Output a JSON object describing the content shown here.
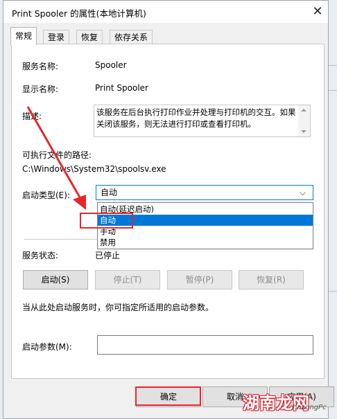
{
  "window": {
    "title": "Print Spooler 的属性(本地计算机)"
  },
  "tabs": [
    {
      "label": "常规",
      "active": true
    },
    {
      "label": "登录"
    },
    {
      "label": "恢复"
    },
    {
      "label": "依存关系"
    }
  ],
  "general": {
    "service_name_label": "服务名称:",
    "service_name_value": "Spooler",
    "display_name_label": "显示名称:",
    "display_name_value": "Print Spooler",
    "description_label": "描述:",
    "description_value": "该服务在后台执行打印作业并处理与打印机的交互。如果关闭该服务，则无法进行打印或查看打印机。",
    "exe_path_label": "可执行文件的路径:",
    "exe_path_value": "C:\\Windows\\System32\\spoolsv.exe",
    "startup_type_label": "启动类型(E):",
    "startup_type_value": "自动",
    "startup_options": [
      "自动(延迟启动)",
      "自动",
      "手动",
      "禁用"
    ],
    "selected_option_index": 1,
    "service_status_label": "服务状态:",
    "service_status_value": "已停止",
    "buttons": {
      "start": "启动(S)",
      "stop": "停止(T)",
      "pause": "暂停(P)",
      "resume": "恢复(R)"
    },
    "start_params_hint": "当从此处启动服务时，你可指定所适用的启动参数。",
    "start_params_label": "启动参数(M):",
    "start_params_value": ""
  },
  "footer": {
    "ok": "确定",
    "cancel": "取消",
    "apply": "应用(A)"
  },
  "annotation": {
    "highlight_color": "#e8262b"
  },
  "watermark": {
    "main": "湖南龙网",
    "sub": "hnLongPc"
  },
  "colors": {
    "accent": "#0078d7",
    "annotation_red": "#e8262b"
  },
  "icons": {
    "close": "close-icon",
    "dropdown": "chevron-down-icon"
  }
}
